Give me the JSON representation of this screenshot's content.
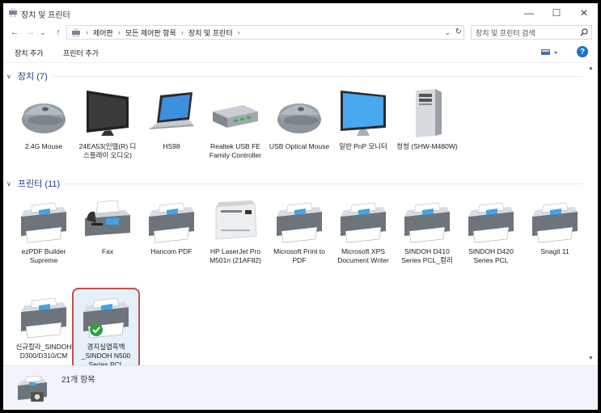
{
  "window": {
    "title": "장치 및 프린터",
    "minimize": "—",
    "maximize": "☐",
    "close": "✕"
  },
  "nav": {
    "back": "←",
    "forward": "→",
    "recent": "⌄",
    "up": "↑",
    "breadcrumbs": [
      "제어판",
      "모든 제어판 항목",
      "장치 및 프린터"
    ],
    "crumb_sep": "›",
    "dropdown": "⌄",
    "refresh": "↻",
    "search_placeholder": "장치 및 프린터 검색"
  },
  "toolbar": {
    "add_device": "장치 추가",
    "add_printer": "프린터 추가",
    "help": "?"
  },
  "groups": {
    "devices": {
      "title": "장치 (7)",
      "items": [
        {
          "label": "2.4G Mouse",
          "icon": "mouse-icon"
        },
        {
          "label": "24EA53(인텔(R) 디스플레이 오디오)",
          "icon": "monitor-icon"
        },
        {
          "label": "HS98",
          "icon": "laptop-icon"
        },
        {
          "label": "Realtek USB FE Family Controller",
          "icon": "network-adapter-icon"
        },
        {
          "label": "USB Optical Mouse",
          "icon": "mouse-icon"
        },
        {
          "label": "일반 PnP 모니터",
          "icon": "monitor-icon"
        },
        {
          "label": "청청 (SHW-M480W)",
          "icon": "tower-icon"
        }
      ]
    },
    "printers": {
      "title": "프린터 (11)",
      "items": [
        {
          "label": "ezPDF Builder Supreme",
          "icon": "printer-icon"
        },
        {
          "label": "Fax",
          "icon": "fax-icon"
        },
        {
          "label": "Hancom PDF",
          "icon": "printer-icon"
        },
        {
          "label": "HP LaserJet Pro M501n (21AF82)",
          "icon": "laser-printer-icon"
        },
        {
          "label": "Microsoft Print to PDF",
          "icon": "printer-icon"
        },
        {
          "label": "Microsoft XPS Document Writer",
          "icon": "printer-icon"
        },
        {
          "label": "SINDOH D410 Series PCL_컬러",
          "icon": "printer-icon"
        },
        {
          "label": "SINDOH D420 Series PCL",
          "icon": "printer-icon"
        },
        {
          "label": "Snagit 11",
          "icon": "printer-icon"
        },
        {
          "label": "신규칼라_SINDOH D300/D310/CM",
          "icon": "printer-icon"
        },
        {
          "label": "경지실엽흑백_SINDOH N500 Series PCL",
          "icon": "printer-icon",
          "default": true
        }
      ]
    }
  },
  "details": {
    "count": "21개 항목"
  },
  "colors": {
    "header_blue": "#1e3f8f",
    "selection_border": "#c0504d",
    "default_check": "#2ea043"
  }
}
